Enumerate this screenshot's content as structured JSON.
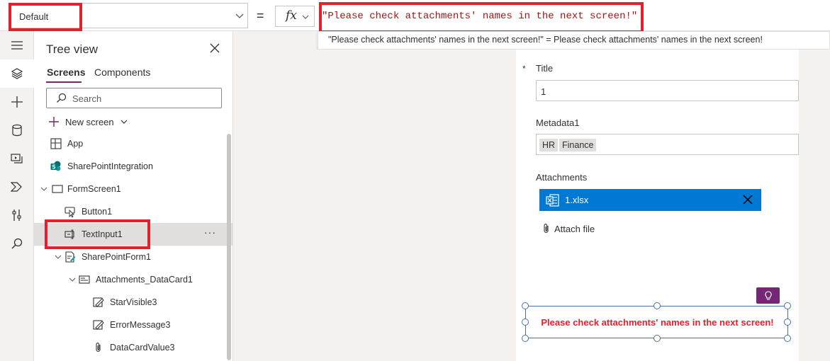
{
  "formula_bar": {
    "property_value": "Default",
    "equals": "=",
    "fx_label": "fx",
    "formula": "\"Please check attachments' names in the next screen!\"",
    "preview": "\"Please check attachments' names in the next screen!\"  =  Please check attachments' names in the next screen!"
  },
  "rail": {
    "items": [
      {
        "icon": "hamburger-icon"
      },
      {
        "icon": "layers-icon"
      },
      {
        "icon": "plus-icon"
      },
      {
        "icon": "database-icon"
      },
      {
        "icon": "media-icon"
      },
      {
        "icon": "power-automate-icon"
      },
      {
        "icon": "tools-icon"
      },
      {
        "icon": "search-icon"
      }
    ]
  },
  "tree": {
    "title": "Tree view",
    "tabs": [
      "Screens",
      "Components"
    ],
    "search_placeholder": "Search",
    "new_screen": "New screen",
    "items": [
      {
        "label": "App",
        "icon": "app-icon"
      },
      {
        "label": "SharePointIntegration",
        "icon": "sharepoint-icon"
      },
      {
        "label": "FormScreen1",
        "icon": "screen-icon"
      },
      {
        "label": "Button1",
        "icon": "button-icon"
      },
      {
        "label": "TextInput1",
        "icon": "text-input-icon"
      },
      {
        "label": "SharePointForm1",
        "icon": "form-icon"
      },
      {
        "label": "Attachments_DataCard1",
        "icon": "datacard-icon"
      },
      {
        "label": "StarVisible3",
        "icon": "label-icon"
      },
      {
        "label": "ErrorMessage3",
        "icon": "label-icon"
      },
      {
        "label": "DataCardValue3",
        "icon": "attachment-icon"
      }
    ],
    "more": "···"
  },
  "form": {
    "required_mark": "*",
    "title_label": "Title",
    "title_value": "1",
    "metadata_label": "Metadata1",
    "tags": [
      "HR",
      "Finance"
    ],
    "attachments_label": "Attachments",
    "attachment_file": "1.xlsx",
    "attach_file": "Attach file",
    "message": "Please check attachments' names in the next screen!"
  },
  "colors": {
    "accent": "#742774",
    "highlight": "#e5202e",
    "attachment_bg": "#0078d4"
  }
}
